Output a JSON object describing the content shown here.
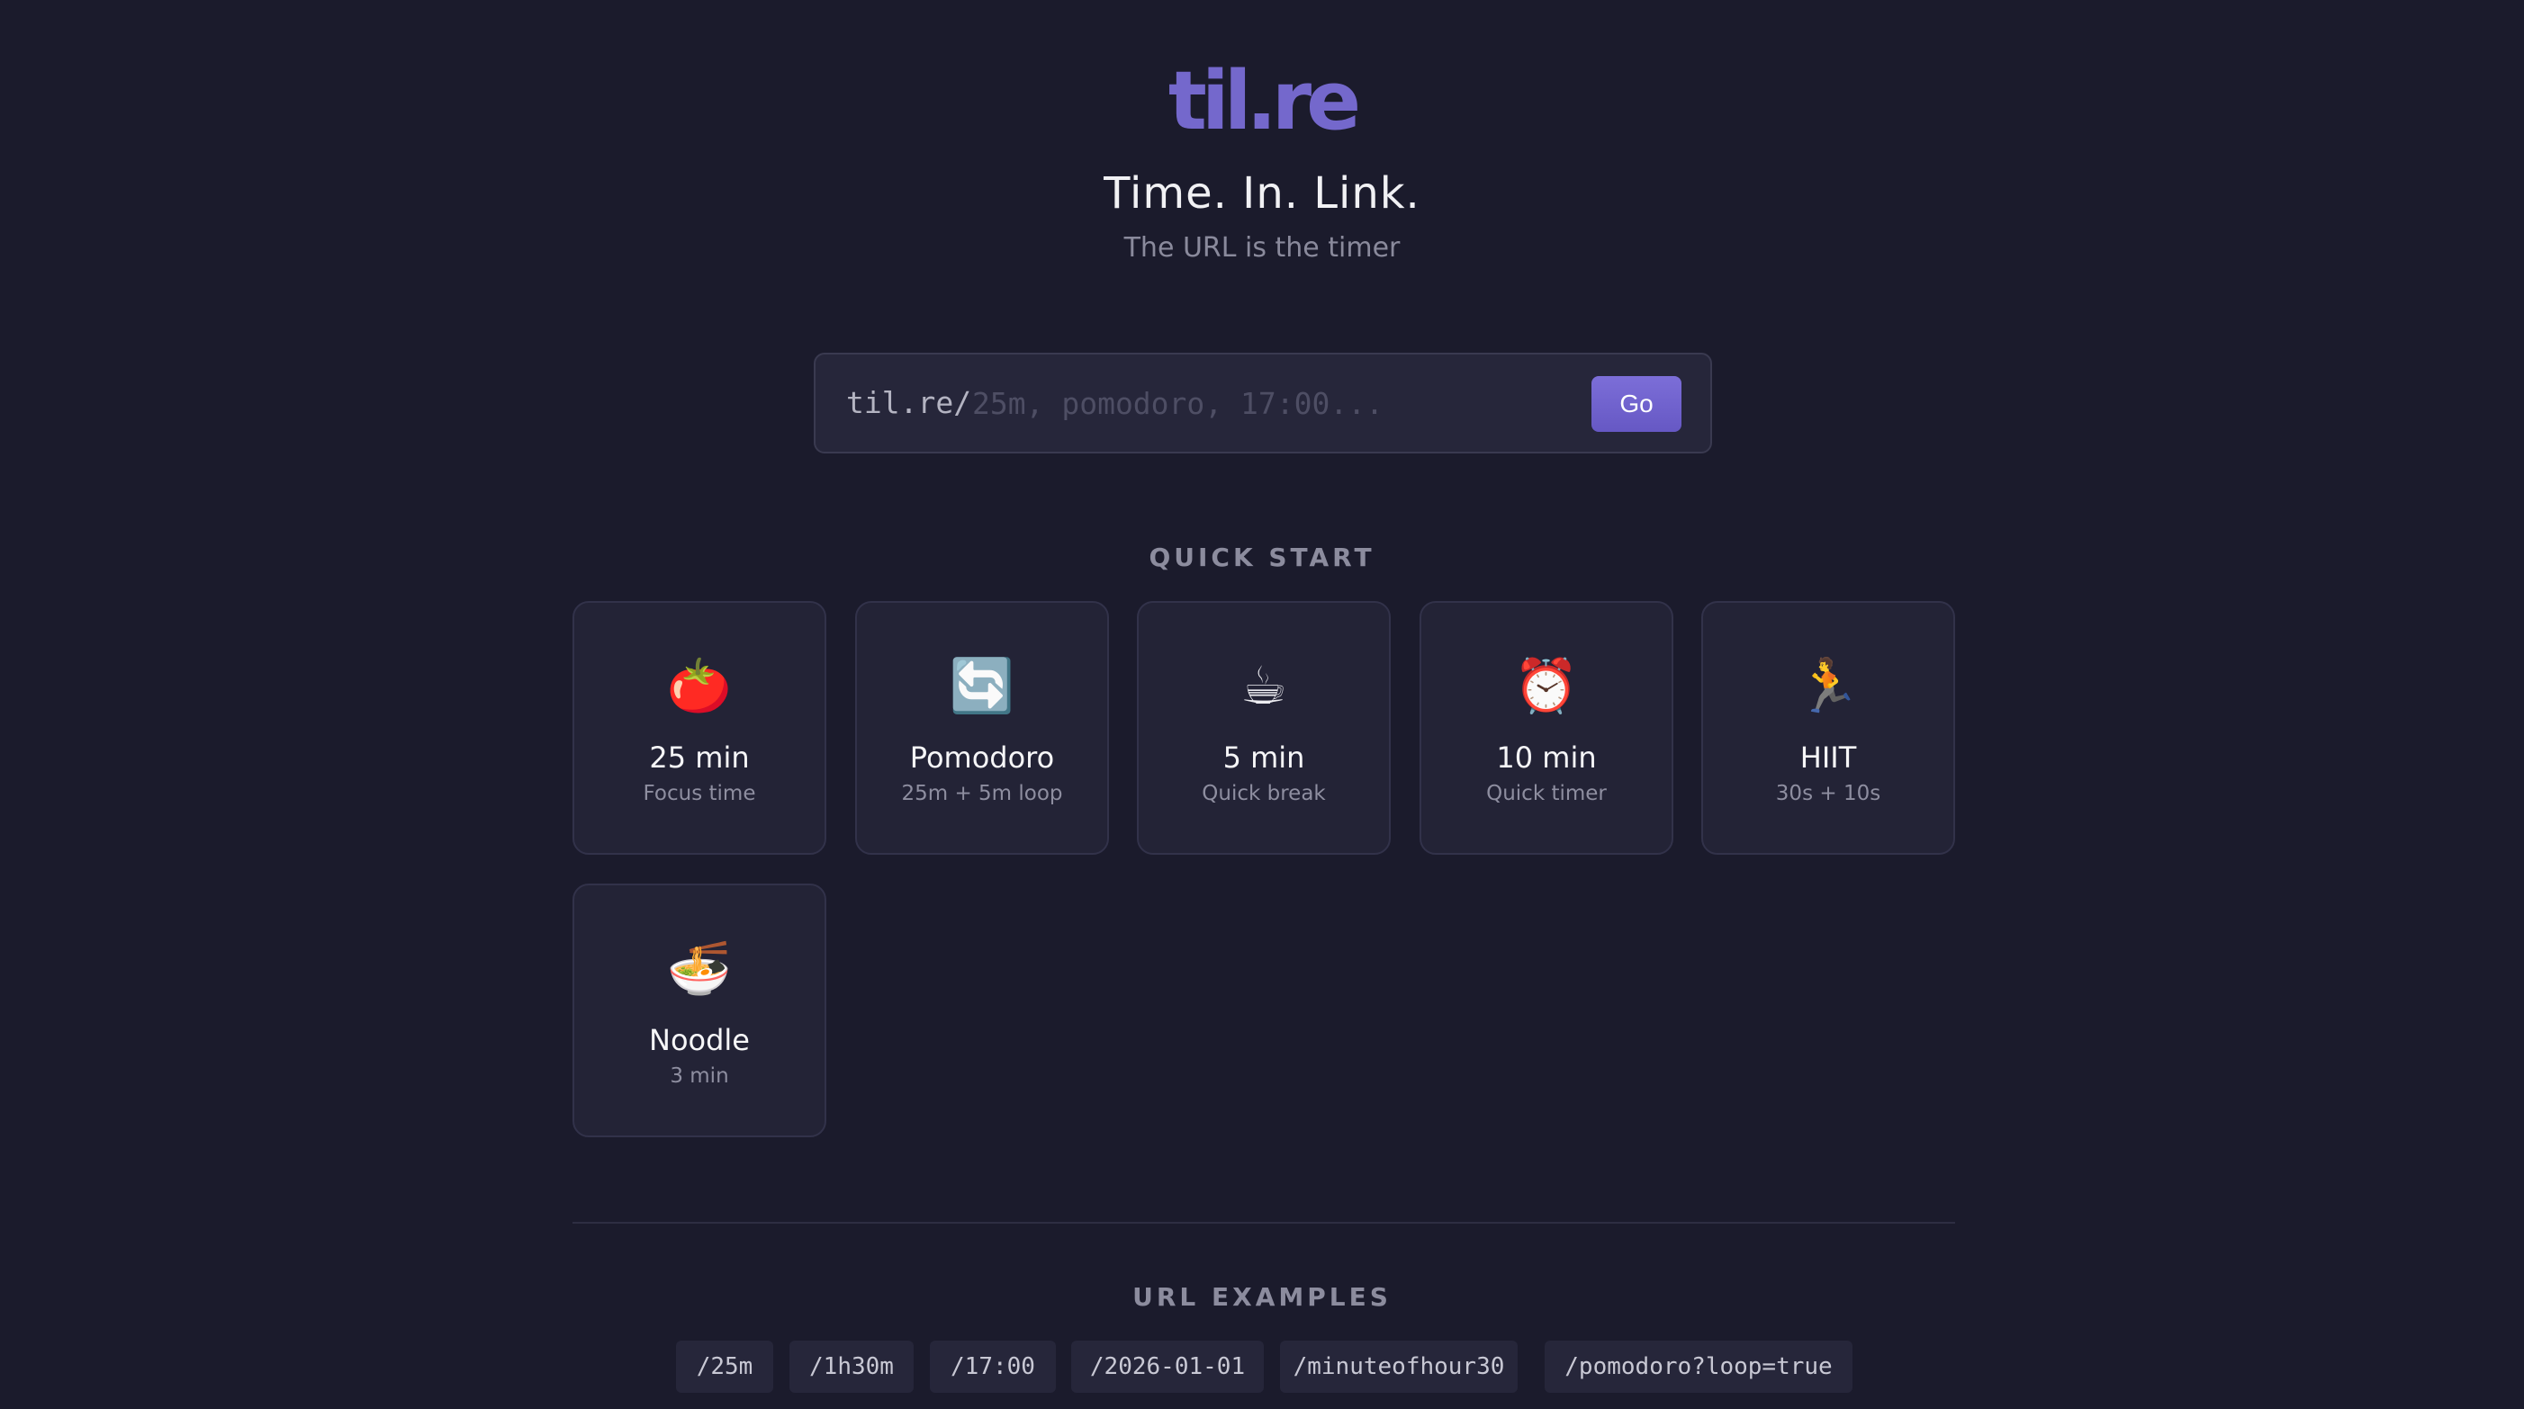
{
  "header": {
    "logo": "til.re",
    "tagline": "Time. In. Link.",
    "subtitle": "The URL is the timer"
  },
  "search": {
    "prefix": "til.re/",
    "placeholder": "25m, pomodoro, 17:00...",
    "value": "",
    "button_label": "Go"
  },
  "quick_start": {
    "label": "QUICK START",
    "cards": [
      {
        "icon": "tomato-icon",
        "glyph": "🍅",
        "title": "25 min",
        "subtitle": "Focus time"
      },
      {
        "icon": "refresh-arrows-icon",
        "glyph": "🔄",
        "title": "Pomodoro",
        "subtitle": "25m + 5m loop"
      },
      {
        "icon": "coffee-cup-icon",
        "glyph": "☕",
        "title": "5 min",
        "subtitle": "Quick break"
      },
      {
        "icon": "alarm-clock-icon",
        "glyph": "⏰",
        "title": "10 min",
        "subtitle": "Quick timer"
      },
      {
        "icon": "runner-icon",
        "glyph": "🏃",
        "title": "HIIT",
        "subtitle": "30s + 10s"
      },
      {
        "icon": "noodle-bowl-icon",
        "glyph": "🍜",
        "title": "Noodle",
        "subtitle": "3 min"
      }
    ]
  },
  "url_examples": {
    "label": "URL EXAMPLES",
    "items": [
      "/25m",
      "/1h30m",
      "/17:00",
      "/2026-01-01",
      "/minuteofhour30",
      "/pomodoro?loop=true"
    ]
  },
  "colors": {
    "background": "#1b1b2c",
    "accent": "#7468cc",
    "card_background": "#232336"
  }
}
